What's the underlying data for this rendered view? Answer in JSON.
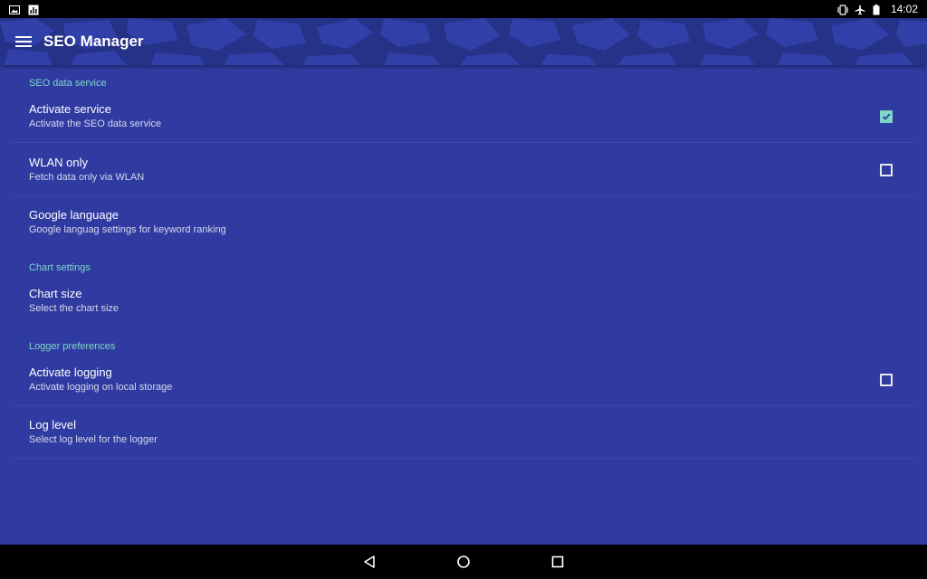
{
  "status_bar": {
    "time": "14:02",
    "left_icons": [
      "image-icon",
      "chart-icon"
    ],
    "right_icons": [
      "vibrate-icon",
      "airplane-icon",
      "battery-icon"
    ]
  },
  "toolbar": {
    "title": "SEO Manager",
    "menu_icon": "menu-icon"
  },
  "colors": {
    "background": "#2f3ba0",
    "toolbar": "#263287",
    "accent": "#7fd6c8"
  },
  "sections": [
    {
      "category": "SEO data service",
      "items": [
        {
          "title": "Activate service",
          "summary": "Activate the SEO data service",
          "checkbox": true,
          "checked": true
        },
        {
          "title": "WLAN only",
          "summary": "Fetch data only via WLAN",
          "checkbox": true,
          "checked": false
        },
        {
          "title": "Google language",
          "summary": "Google languag settings for keyword ranking",
          "checkbox": false
        }
      ]
    },
    {
      "category": "Chart settings",
      "items": [
        {
          "title": "Chart size",
          "summary": "Select the chart size",
          "checkbox": false
        }
      ]
    },
    {
      "category": "Logger preferences",
      "items": [
        {
          "title": "Activate logging",
          "summary": "Activate logging on local storage",
          "checkbox": true,
          "checked": false
        },
        {
          "title": "Log level",
          "summary": "Select log level for the logger",
          "checkbox": false
        }
      ]
    }
  ],
  "nav_bar": {
    "buttons": [
      "back-icon",
      "home-icon",
      "recents-icon"
    ]
  }
}
